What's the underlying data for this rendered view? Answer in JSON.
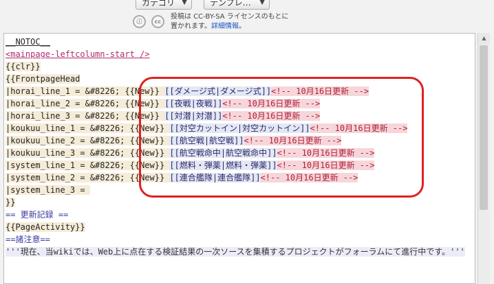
{
  "toolbar": {
    "category_select": "カテゴリ",
    "template_select": "テンプレ…",
    "license_line1": "投稿は CC-BY-SA ライセンスのもとに",
    "license_line2_prefix": "置かれます。",
    "license_link": "詳細情報",
    "license_line2_suffix": "。",
    "icon1": "ⓘ",
    "icon2": "cc"
  },
  "editor": {
    "lines": [
      {
        "t": "__NOTOC__"
      },
      {
        "t": "<mainpage-leftcolumn-start />"
      },
      {
        "t": "{{clr}}"
      },
      {
        "t": "{{FrontpageHead"
      },
      {
        "a": "|horai_line_1 = &#8226; {{New}} ",
        "b": "[[ダメージ式|ダメージ式]]",
        "c": "<!-- 10月16日更新 -->"
      },
      {
        "a": "|horai_line_2 = &#8226; {{New}} ",
        "b": "[[夜戦|夜戦]]",
        "c": "<!-- 10月16日更新 -->"
      },
      {
        "a": "|horai_line_3 = &#8226; {{New}} ",
        "b": "[[対潜|対潜]]",
        "c": "<!-- 10月16日更新 -->"
      },
      {
        "a": "|koukuu_line_1 = &#8226; {{New}} ",
        "b": "[[対空カットイン|対空カットイン]]",
        "c": "<!-- 10月16日更新 -->"
      },
      {
        "a": "|koukuu_line_2 = &#8226; {{New}} ",
        "b": "[[航空戦|航空戦]]",
        "c": "<!-- 10月16日更新 -->"
      },
      {
        "a": "|koukuu_line_3 = &#8226; {{New}} ",
        "b": "[[航空戦命中|航空戦命中]]",
        "c": "<!-- 10月16日更新 -->"
      },
      {
        "a": "|system_line_1 = &#8226; {{New}} ",
        "b": "[[燃料・弾薬|燃料・弾薬]]",
        "c": "<!-- 10月16日更新 -->"
      },
      {
        "a": "|system_line_2 = &#8226; {{New}} ",
        "b": "[[連合艦隊|連合艦隊]]",
        "c": "<!-- 10月16日更新 -->"
      },
      {
        "a": "|system_line_3 = "
      },
      {
        "t": "}}"
      },
      {
        "t": "== 更新記録 =="
      },
      {
        "t": "{{PageActivity}}"
      },
      {
        "t": "==諸注意=="
      },
      {
        "t": "'''現在、当wikiでは、Web上に点在する検証結果の一次ソースを集積するプロジェクトがフォーラムにて進行中です。'''"
      }
    ]
  }
}
